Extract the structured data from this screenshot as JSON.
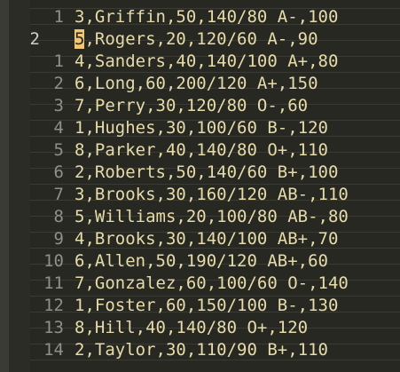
{
  "editor": {
    "active_line": 1,
    "cursor_char": "5",
    "lines": [
      {
        "number": "1",
        "text": "3,Griffin,50,140/80 A-,100"
      },
      {
        "number": "2",
        "text": ",Rogers,20,120/60 A-,90"
      },
      {
        "number": "1",
        "text": "4,Sanders,40,140/100 A+,80"
      },
      {
        "number": "2",
        "text": "6,Long,60,200/120 A+,150"
      },
      {
        "number": "3",
        "text": "7,Perry,30,120/80 O-,60"
      },
      {
        "number": "4",
        "text": "1,Hughes,30,100/60 B-,120"
      },
      {
        "number": "5",
        "text": "8,Parker,40,140/80 O+,110"
      },
      {
        "number": "6",
        "text": "2,Roberts,50,140/60 B+,100"
      },
      {
        "number": "7",
        "text": "3,Brooks,30,160/120 AB-,110"
      },
      {
        "number": "8",
        "text": "5,Williams,20,100/80 AB-,80"
      },
      {
        "number": "9",
        "text": "4,Brooks,30,140/100 AB+,70"
      },
      {
        "number": "10",
        "text": "6,Allen,50,190/120 AB+,60"
      },
      {
        "number": "11",
        "text": "7,Gonzalez,60,100/60 O-,140"
      },
      {
        "number": "12",
        "text": "1,Foster,60,150/100 B-,130"
      },
      {
        "number": "13",
        "text": "8,Hill,40,140/80 O+,120"
      },
      {
        "number": "14",
        "text": "2,Taylor,30,110/90 B+,110"
      }
    ]
  }
}
